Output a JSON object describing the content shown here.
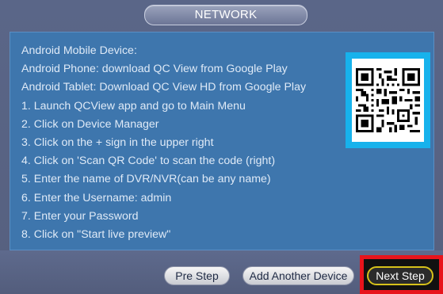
{
  "dialog": {
    "title": "NETWORK"
  },
  "instructions": [
    "Android Mobile Device:",
    "Android Phone: download QC View from Google Play",
    "Android Tablet: Download QC View HD from Google Play",
    "1. Launch QCView app and go to Main Menu",
    "2. Click on Device Manager",
    "3. Click on the + sign in the upper right",
    "4. Click on 'Scan QR Code' to scan the code (right)",
    "5. Enter the name of DVR/NVR(can be any name)",
    "6. Enter the Username: admin",
    "7. Enter your Password",
    "8. Click on \"Start live preview\""
  ],
  "qr": {
    "icon": "qr-code-icon",
    "frame_color": "#17b2ec"
  },
  "buttons": {
    "pre_step": "Pre Step",
    "add_another_device": "Add Another Device",
    "next_step": "Next Step"
  },
  "colors": {
    "content_bg": "#3e76ad",
    "highlight": "#e8141c",
    "next_border": "#d7c21a"
  }
}
